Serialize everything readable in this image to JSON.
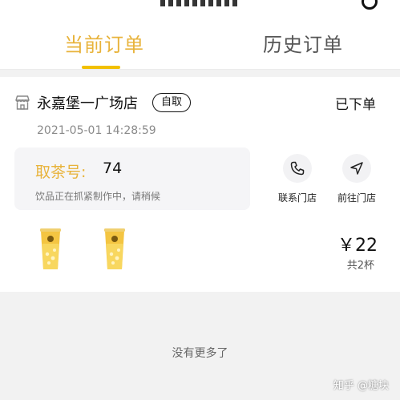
{
  "tabs": {
    "current": "当前订单",
    "history": "历史订单"
  },
  "order": {
    "store_name": "永嘉堡一广场店",
    "pickup_mode": "自取",
    "status": "已下单",
    "time": "2021-05-01 14:28:59",
    "pickup_label": "取茶号:",
    "pickup_number": "74",
    "note": "饮品正在抓紧制作中，请稍候",
    "actions": {
      "contact": "联系门店",
      "navigate": "前往门店"
    },
    "price": "￥22",
    "count": "共2杯"
  },
  "footer": {
    "no_more": "没有更多了"
  },
  "watermark": "知乎 @糖块",
  "colors": {
    "accent": "#e8b33b",
    "underline": "#f2c000",
    "background": "#f2f2f2"
  },
  "icons": {
    "store": "store-icon",
    "phone": "phone-icon",
    "navigate": "navigation-arrow-icon",
    "drink": "drink-cup-icon"
  }
}
